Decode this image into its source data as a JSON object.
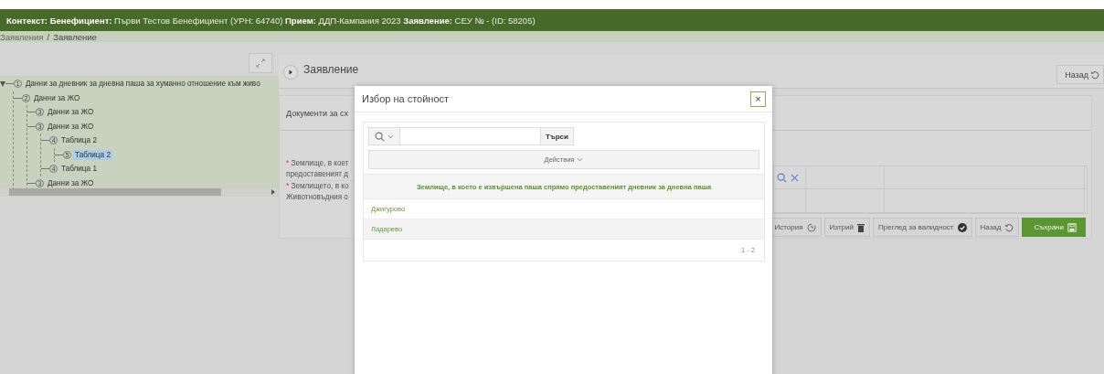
{
  "header": {
    "context": "**Контекст: Бенефициент:** Първи Тестов Бенефициент (УРН: 64740) **Прием:** ДДП-Кампания 2023 **Заявление:** СЕУ № - (ID: 58205)"
  },
  "breadcrumb": {
    "separator": "/",
    "items": [
      {
        "label": "Заявления",
        "kind": "link"
      },
      {
        "label": "Заявление",
        "kind": "current"
      }
    ]
  },
  "tree": [
    {
      "number": "1",
      "label": "Данни за дневник за дневна паша за хуманно отношение към живо",
      "selected": false,
      "children": [
        {
          "number": "2",
          "label": "Данни за ЖО",
          "selected": false,
          "children": [
            {
              "number": "3",
              "label": "Данни за ЖО",
              "selected": false
            },
            {
              "number": "3",
              "label": "Данни за ЖО",
              "selected": false,
              "children": [
                {
                  "number": "4",
                  "label": "Таблица 2",
                  "selected": false,
                  "children": [
                    {
                      "number": "5",
                      "label": "Таблица 2",
                      "selected": true
                    }
                  ]
                },
                {
                  "number": "4",
                  "label": "Таблица 1",
                  "selected": false
                }
              ]
            },
            {
              "number": "3",
              "label": "Данни за ЖО",
              "selected": false
            }
          ]
        }
      ]
    }
  ],
  "application_panel": {
    "title": "Заявление",
    "back_button": "Назад"
  },
  "documents_panel": {
    "title": "Документи за сх",
    "fields": [
      {
        "mark": "*",
        "lines": [
          "Землище, в коет",
          "предоставеният д"
        ]
      },
      {
        "mark": "*",
        "lines": [
          "Землището, в ко",
          "Животновъдния о"
        ]
      }
    ],
    "actions": [
      {
        "label": "История",
        "kind": "history"
      },
      {
        "label": "Изтрий",
        "kind": "delete"
      },
      {
        "label": "Преглед за валидност",
        "kind": "validate"
      },
      {
        "label": "Назад",
        "kind": "back"
      },
      {
        "label": "Съхрани",
        "kind": "save"
      }
    ]
  },
  "modal": {
    "title": "Избор на стойност",
    "close": "×",
    "search_button": "Търси",
    "actions_menu": "Действия",
    "table": {
      "column": "Землище, в което е извършена паша спрямо предоставеният дневник за дневна паша",
      "rows": [
        "Джигурово",
        "Ладарево"
      ],
      "pagination": "1 - 2"
    }
  }
}
